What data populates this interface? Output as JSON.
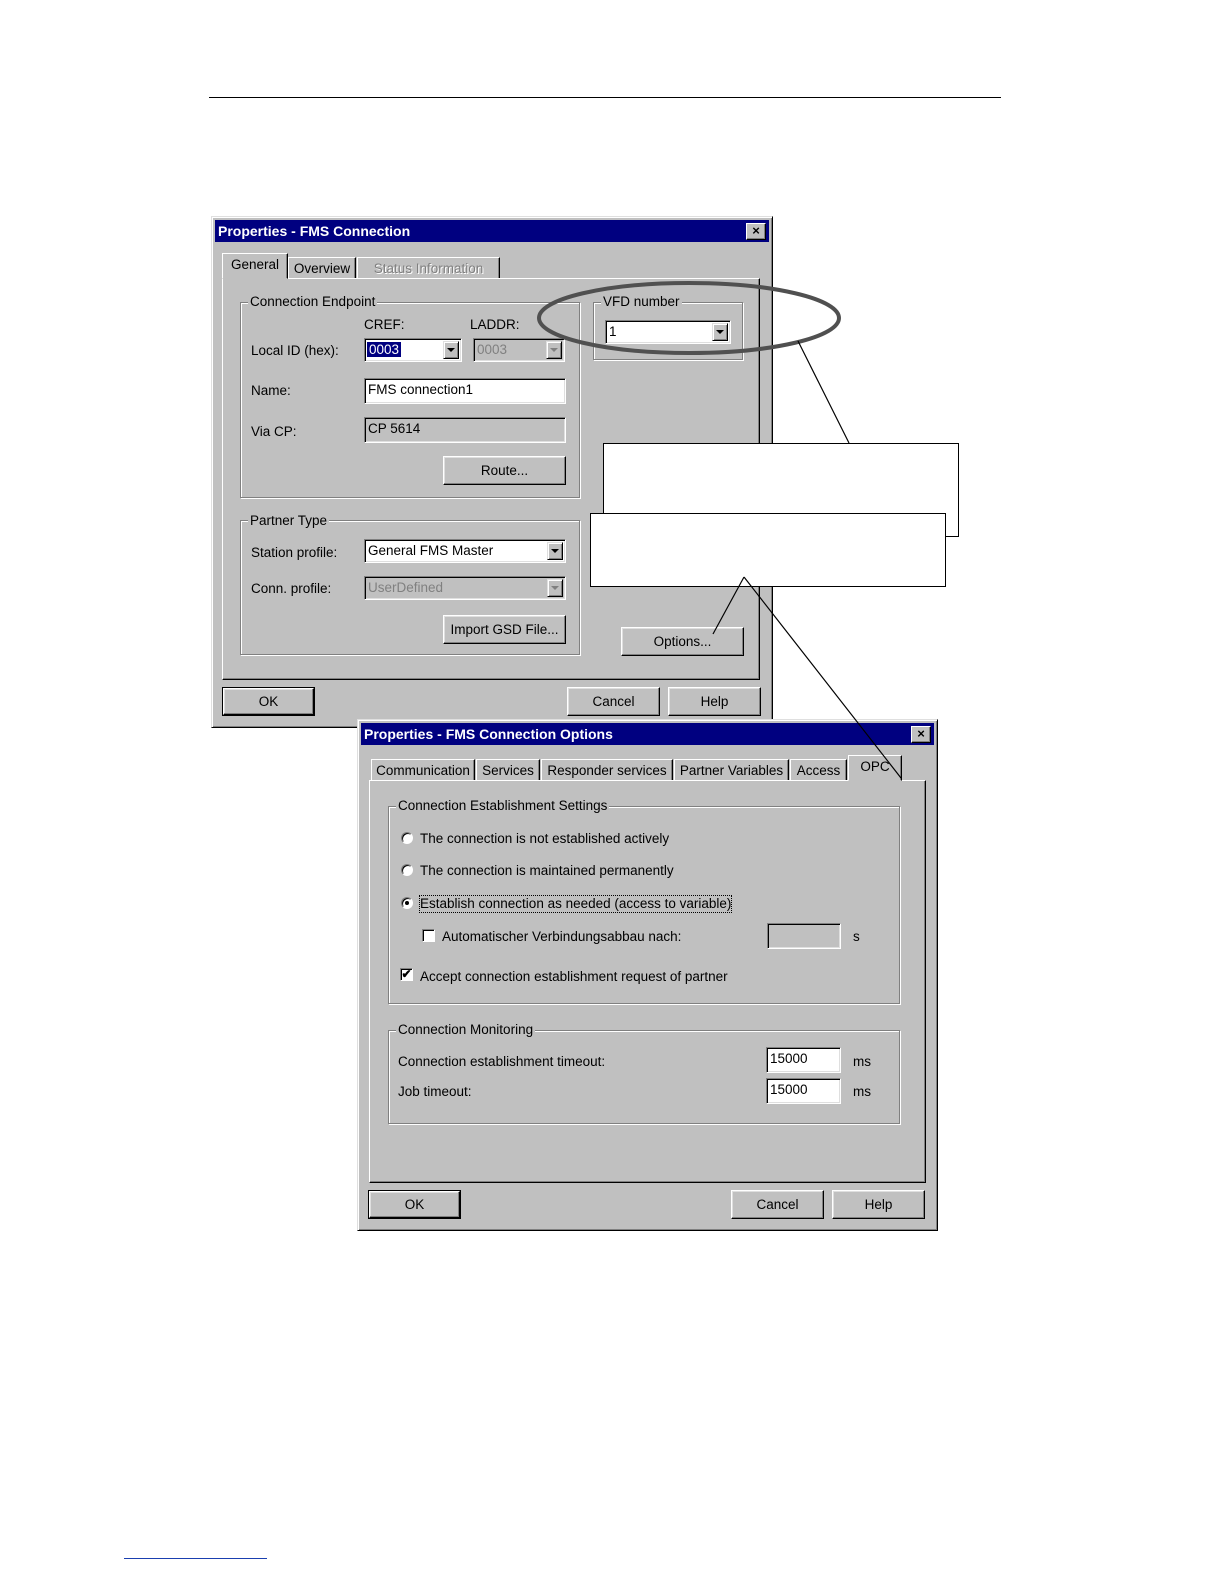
{
  "dialog1": {
    "title": "Properties - FMS Connection",
    "close": "×",
    "tabs": [
      "General",
      "Overview",
      "Status Information"
    ],
    "endpoint": {
      "group_label": "Connection Endpoint",
      "cref_label": "CREF:",
      "laddr_label": "LADDR:",
      "local_id_label": "Local ID (hex):",
      "local_id_value": "0003",
      "laddr_value": "0003",
      "name_label": "Name:",
      "name_value": "FMS connection1",
      "via_cp_label": "Via CP:",
      "via_cp_value": "CP 5614",
      "route_button": "Route..."
    },
    "vfd": {
      "group_label": "VFD number",
      "value": "1"
    },
    "partner": {
      "group_label": "Partner Type",
      "station_profile_label": "Station profile:",
      "station_profile_value": "General FMS Master",
      "conn_profile_label": "Conn. profile:",
      "conn_profile_value": "UserDefined",
      "import_gsd_button": "Import GSD File..."
    },
    "options_button": "Options...",
    "ok_button": "OK",
    "cancel_button": "Cancel",
    "help_button": "Help"
  },
  "dialog2": {
    "title": "Properties - FMS Connection Options",
    "close": "×",
    "tabs": [
      "Communication",
      "Services",
      "Responder services",
      "Partner Variables",
      "Access",
      "OPC"
    ],
    "establishment": {
      "group_label": "Connection Establishment Settings",
      "radio1": "The connection is not established actively",
      "radio2": "The connection is maintained permanently",
      "radio3": "Establish connection as needed (access to variable)",
      "auto_label": "Automatischer Verbindungsabbau nach:",
      "auto_value": "",
      "auto_unit": "s",
      "accept_label": "Accept connection establishment request of partner",
      "accept_mark": "✔"
    },
    "monitoring": {
      "group_label": "Connection Monitoring",
      "est_timeout_label": "Connection establishment timeout:",
      "est_timeout_value": "15000",
      "est_timeout_unit": "ms",
      "job_timeout_label": "Job timeout:",
      "job_timeout_value": "15000",
      "job_timeout_unit": "ms"
    },
    "ok_button": "OK",
    "cancel_button": "Cancel",
    "help_button": "Help"
  }
}
